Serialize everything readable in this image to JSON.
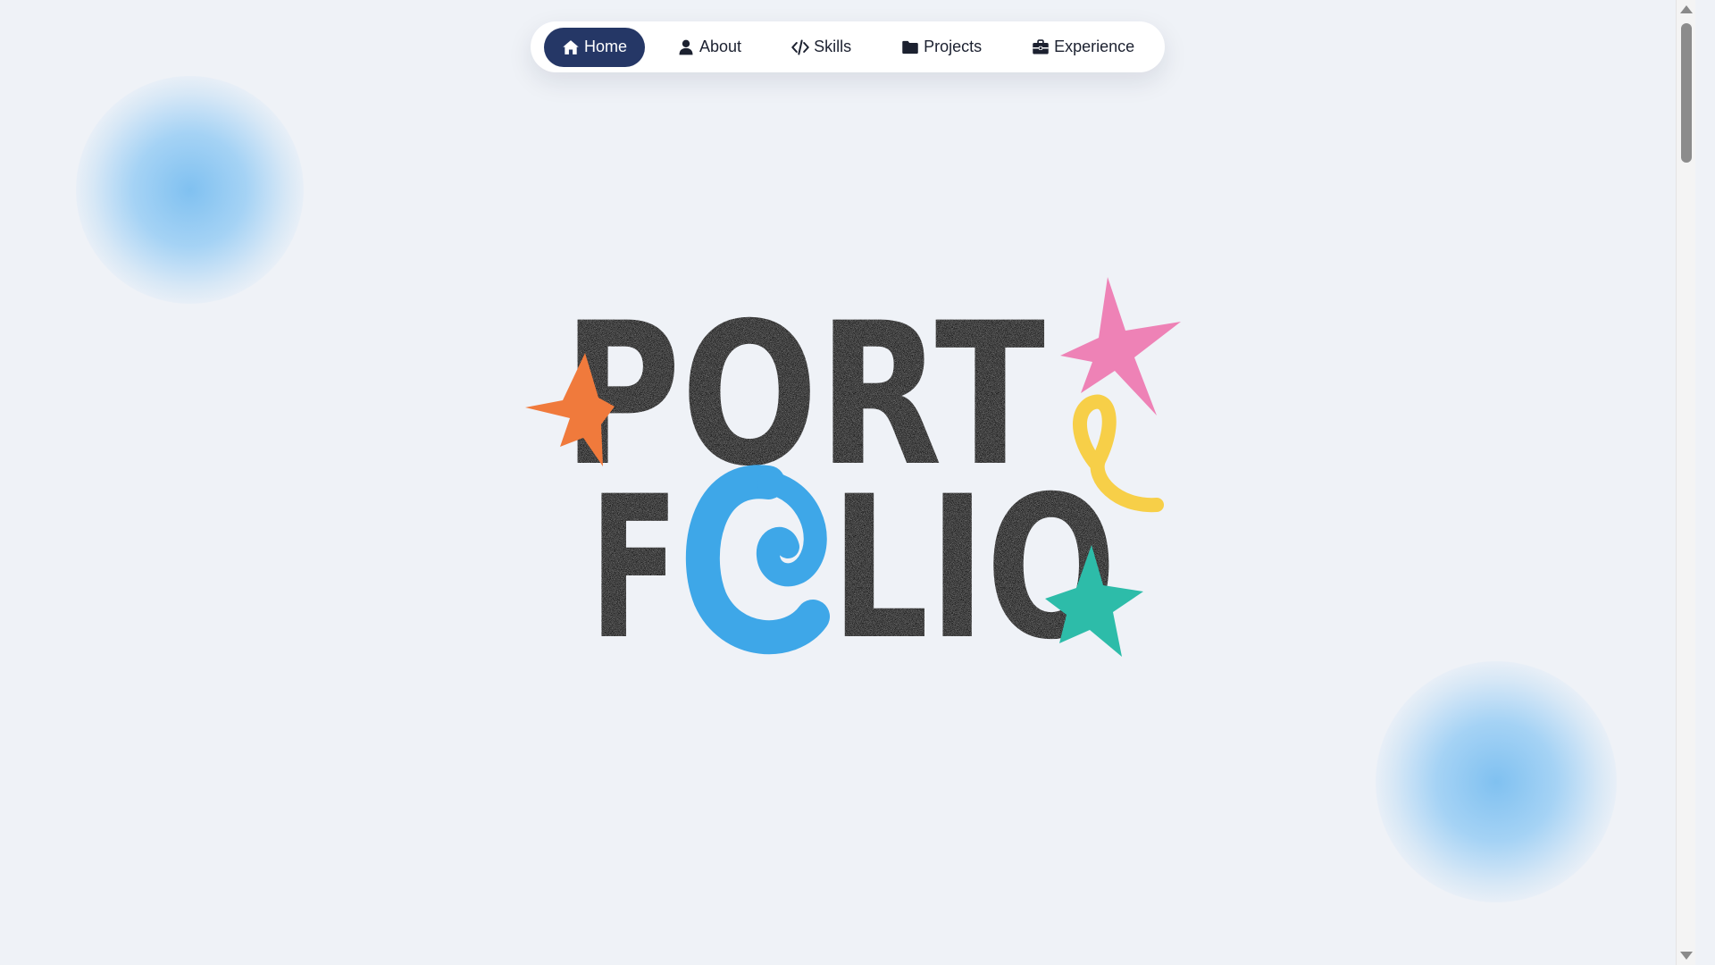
{
  "nav": {
    "items": [
      {
        "label": "Home",
        "icon": "home-icon",
        "active": true
      },
      {
        "label": "About",
        "icon": "user-icon",
        "active": false
      },
      {
        "label": "Skills",
        "icon": "code-icon",
        "active": false
      },
      {
        "label": "Projects",
        "icon": "folder-icon",
        "active": false
      },
      {
        "label": "Experience",
        "icon": "briefcase-icon",
        "active": false
      }
    ]
  },
  "hero": {
    "line1": "PORT",
    "line2_start": "F",
    "line2_end": "LIO",
    "colors": {
      "letters": "#1f1f1f",
      "orange_star": "#f07a3c",
      "pink_star": "#ee82b6",
      "yellow_squiggle": "#f7cf48",
      "blue_swirl": "#3ea7e8",
      "teal_star": "#2dbca9"
    }
  },
  "colors": {
    "background": "#eff2f7",
    "nav_active": "#253766",
    "blob": "#8cc8f4"
  }
}
